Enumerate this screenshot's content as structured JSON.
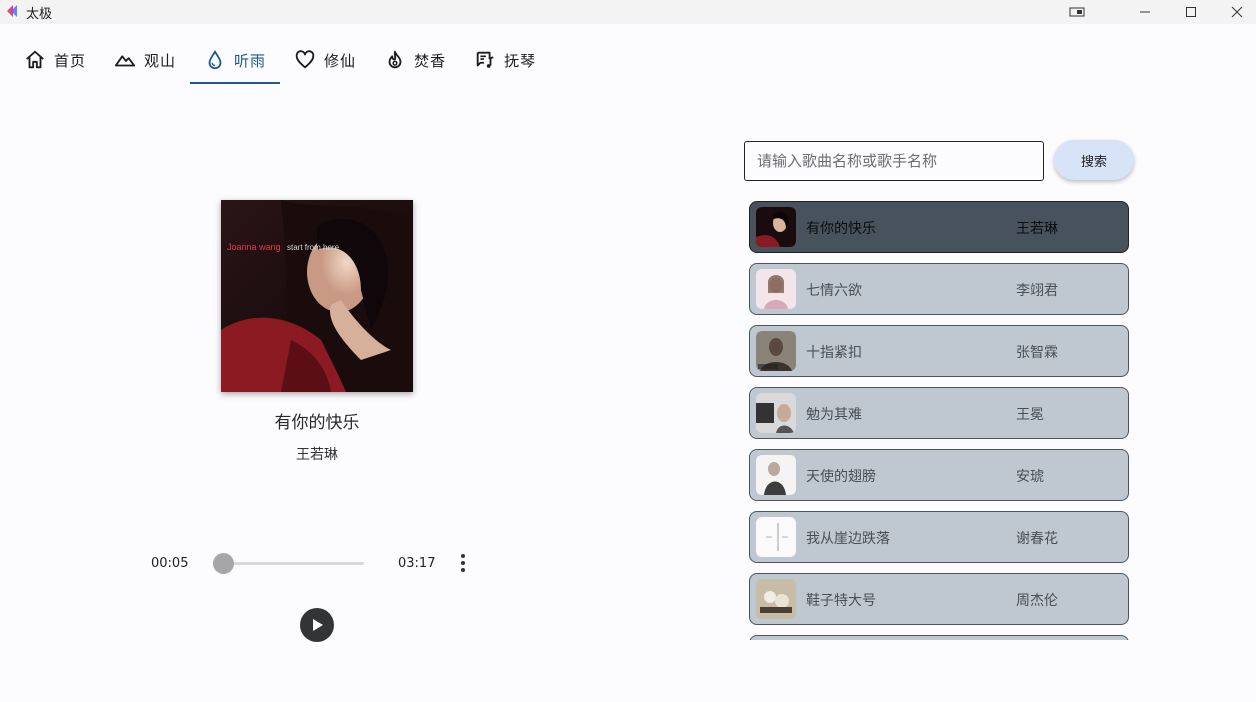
{
  "window": {
    "title": "太极",
    "controls": [
      "restore-icon",
      "minimize-icon",
      "maximize-icon",
      "close-icon"
    ]
  },
  "nav": {
    "tabs": [
      {
        "label": "首页",
        "icon": "home-icon"
      },
      {
        "label": "观山",
        "icon": "mountain-icon"
      },
      {
        "label": "听雨",
        "icon": "water-drop-icon",
        "active": true
      },
      {
        "label": "修仙",
        "icon": "heart-icon"
      },
      {
        "label": "焚香",
        "icon": "flame-icon"
      },
      {
        "label": "抚琴",
        "icon": "music-note-icon"
      }
    ],
    "accent": "#1e5a8c"
  },
  "player": {
    "title": "有你的快乐",
    "artist": "王若琳",
    "current_time": "00:05",
    "total_time": "03:17",
    "progress": 0.03,
    "cover_text": "Joanna wang",
    "cover_subtext": "start from here"
  },
  "search": {
    "placeholder": "请输入歌曲名称或歌手名称",
    "value": "",
    "button_label": "搜索"
  },
  "songs": [
    {
      "title": "有你的快乐",
      "artist": "王若琳",
      "selected": true
    },
    {
      "title": "七情六欲",
      "artist": "李翊君"
    },
    {
      "title": "十指紧扣",
      "artist": "张智霖"
    },
    {
      "title": "勉为其难",
      "artist": "王冕"
    },
    {
      "title": "天使的翅膀",
      "artist": "安琥"
    },
    {
      "title": "我从崖边跌落",
      "artist": "谢春花"
    },
    {
      "title": "鞋子特大号",
      "artist": "周杰伦"
    }
  ],
  "colors": {
    "selected_row": "#47525c",
    "row": "#bfc8d0",
    "search_button": "#d7e3f7"
  }
}
